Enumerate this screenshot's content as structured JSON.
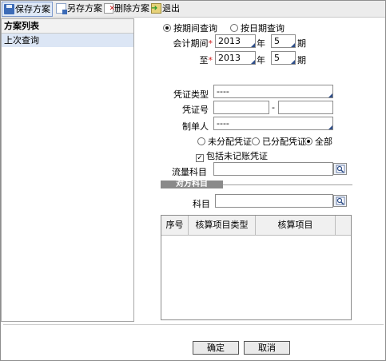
{
  "toolbar": {
    "save": "保存方案",
    "save_as": "另存方案",
    "delete": "删除方案",
    "exit": "退出"
  },
  "left_panel": {
    "title": "方案列表",
    "items": [
      "上次查询"
    ]
  },
  "query_mode": {
    "by_period": "按期间查询",
    "by_date": "按日期查询",
    "selected": "by_period"
  },
  "period": {
    "from_label": "会计期间",
    "to_label": "至",
    "year_unit": "年",
    "period_unit": "期",
    "from_year": "2013",
    "from_period": "5",
    "to_year": "2013",
    "to_period": "5"
  },
  "voucher_type": {
    "label": "凭证类型",
    "value": "----"
  },
  "voucher_no": {
    "label": "凭证号",
    "from": "",
    "sep": "-",
    "to": ""
  },
  "maker": {
    "label": "制单人",
    "value": "----"
  },
  "distribution": {
    "unassigned": "未分配凭证",
    "assigned": "已分配凭证",
    "all": "全部",
    "selected": "all"
  },
  "include_unposted": {
    "label": "包括未记账凭证",
    "checked": "✓"
  },
  "cashflow_subject": {
    "label": "流量科目",
    "value": ""
  },
  "counter_section": {
    "title": "对方科目",
    "subject_label": "科目",
    "subject_value": ""
  },
  "grid": {
    "columns": [
      "序号",
      "核算项目类型",
      "核算项目"
    ]
  },
  "buttons": {
    "ok": "确定",
    "cancel": "取消"
  },
  "colors": {
    "selection": "#dce6f5",
    "required": "#d21d1d",
    "lookup_accent": "#2f4f8a"
  }
}
